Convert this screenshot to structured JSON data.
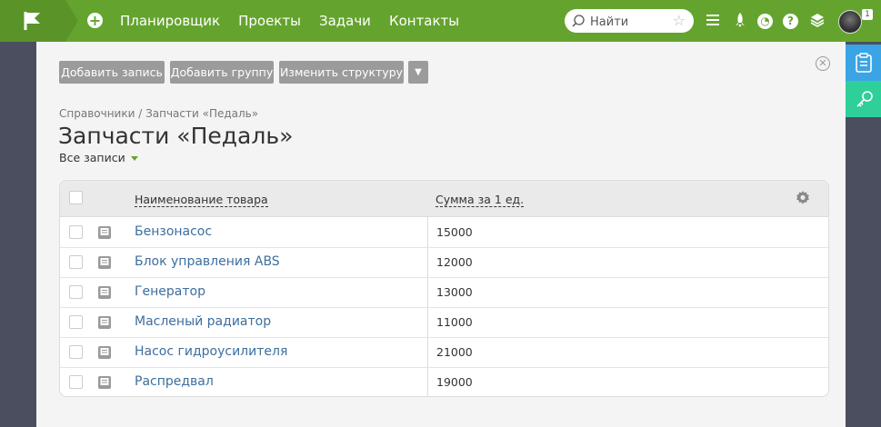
{
  "header": {
    "nav": [
      "Планировщик",
      "Проекты",
      "Задачи",
      "Контакты"
    ],
    "search_placeholder": "Найти",
    "notification_count": "1",
    "icons": [
      "flag-icon",
      "plus-icon",
      "menu-icon",
      "rocket-icon",
      "timer-icon",
      "help-icon",
      "layers-icon",
      "star-icon",
      "search-icon"
    ],
    "colors": {
      "bar": "#64a42e",
      "bar_dark": "#5a9428"
    }
  },
  "toolbar": {
    "add_record": "Добавить запись",
    "add_group": "Добавить группу",
    "edit_structure": "Изменить структуру",
    "more": "▼"
  },
  "breadcrumb": "Справочники / Запчасти «Педаль»",
  "title": "Запчасти «Педаль»",
  "filter": "Все записи",
  "table": {
    "columns": [
      "Наименование товара",
      "Сумма за 1 ед."
    ],
    "rows": [
      {
        "name": "Бензонасос",
        "sum": "15000"
      },
      {
        "name": "Блок управления ABS",
        "sum": "12000"
      },
      {
        "name": "Генератор",
        "sum": "13000"
      },
      {
        "name": "Масленый радиатор",
        "sum": "11000"
      },
      {
        "name": "Насос гидроусилителя",
        "sum": "21000"
      },
      {
        "name": "Распредвал",
        "sum": "19000"
      }
    ]
  },
  "sidebar": {
    "tabs": [
      "notes-icon",
      "key-icon"
    ],
    "colors": {
      "notes": "#3ba4e4",
      "key": "#2fcf9a"
    }
  }
}
